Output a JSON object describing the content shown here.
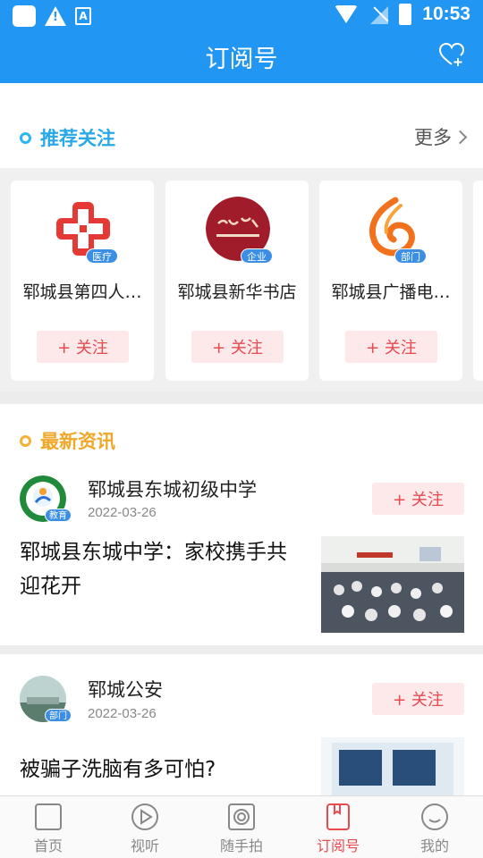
{
  "status_bar": {
    "time": "10:53"
  },
  "header": {
    "title": "订阅号"
  },
  "recommended": {
    "title": "推荐关注",
    "more": "更多",
    "accounts": [
      {
        "name": "郓城县第四人…",
        "tag": "医疗",
        "follow": "+ 关注"
      },
      {
        "name": "郓城县新华书店",
        "tag": "企业",
        "follow": "+ 关注"
      },
      {
        "name": "郓城县广播电…",
        "tag": "部门",
        "follow": "+ 关注"
      }
    ]
  },
  "latest": {
    "title": "最新资讯",
    "items": [
      {
        "source": "郓城县东城初级中学",
        "tag": "教育",
        "date": "2022-03-26",
        "follow": "+ 关注",
        "headline": "郓城县东城中学：家校携手共迎花开"
      },
      {
        "source": "郓城公安",
        "tag": "部门",
        "date": "2022-03-26",
        "follow": "+ 关注",
        "headline": "被骗子洗脑有多可怕?"
      }
    ]
  },
  "tabs": [
    {
      "label": "首页",
      "icon": "home-square-icon"
    },
    {
      "label": "视听",
      "icon": "play-icon"
    },
    {
      "label": "随手拍",
      "icon": "camera-icon"
    },
    {
      "label": "订阅号",
      "icon": "bookmark-icon",
      "active": true
    },
    {
      "label": "我的",
      "icon": "smile-icon"
    }
  ],
  "colors": {
    "primary": "#2196f3",
    "accent": "#e64a4f",
    "section1_dot": "#29b6f6",
    "section2_dot": "#f5b335",
    "section1_text": "#29a8e8",
    "section2_text": "#f0a82a"
  }
}
